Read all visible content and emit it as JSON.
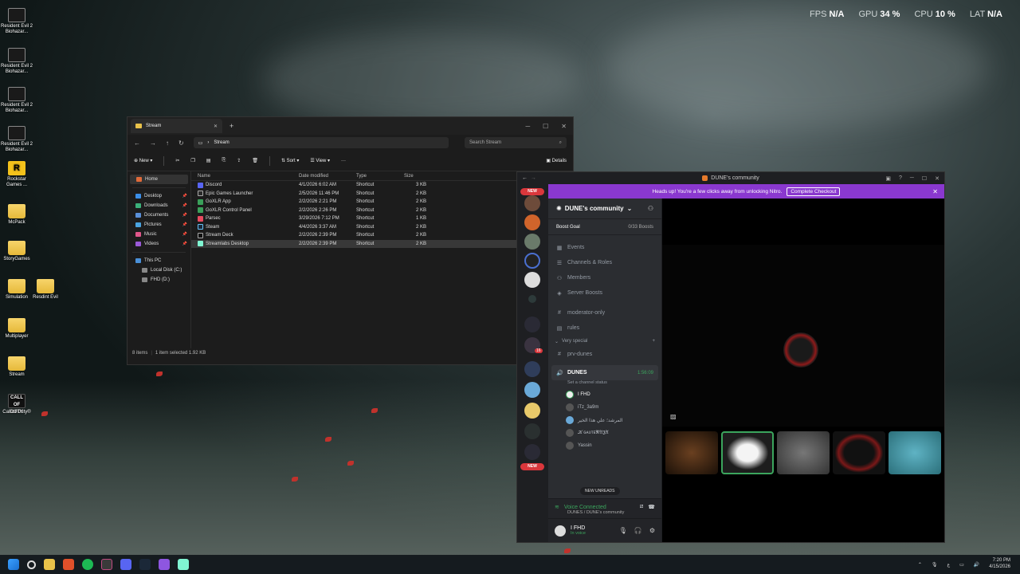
{
  "overlay": {
    "fps_label": "FPS",
    "fps": "N/A",
    "gpu_label": "GPU",
    "gpu": "34 %",
    "cpu_label": "CPU",
    "cpu": "10 %",
    "lat_label": "LAT",
    "lat": "N/A"
  },
  "desktop": {
    "icons": [
      {
        "label": "Resident Evil 2 Biohazar..."
      },
      {
        "label": "Resident Evil 2 Biohazar..."
      },
      {
        "label": "Resident Evil 2 Biohazar..."
      },
      {
        "label": "Resident Evil 2 Biohazar..."
      },
      {
        "label": "Rockstar Games ..."
      },
      {
        "label": "McPack"
      },
      {
        "label": "StoryGames"
      },
      {
        "label": "Simulation"
      },
      {
        "label": "Resdint Evil"
      },
      {
        "label": "Multiplayer"
      },
      {
        "label": "Stream"
      },
      {
        "label": "Call of Duty®"
      }
    ]
  },
  "explorer": {
    "tab_title": "Stream",
    "address": "Stream",
    "search_placeholder": "Search Stream",
    "toolbar": {
      "new": "New",
      "sort": "Sort",
      "view": "View",
      "details": "Details"
    },
    "nav": {
      "home": "Home",
      "desktop": "Desktop",
      "downloads": "Downloads",
      "documents": "Documents",
      "pictures": "Pictures",
      "music": "Music",
      "videos": "Videos",
      "this_pc": "This PC",
      "local_disk": "Local Disk (C:)",
      "fhd": "FHD (D:)"
    },
    "columns": {
      "name": "Name",
      "date": "Date modified",
      "type": "Type",
      "size": "Size"
    },
    "files": [
      {
        "name": "Discord",
        "date": "4/1/2026 6:02 AM",
        "type": "Shortcut",
        "size": "3 KB"
      },
      {
        "name": "Epic Games Launcher",
        "date": "2/5/2026 11:46 PM",
        "type": "Shortcut",
        "size": "2 KB"
      },
      {
        "name": "GoXLR App",
        "date": "2/2/2026 2:21 PM",
        "type": "Shortcut",
        "size": "2 KB"
      },
      {
        "name": "GoXLR Control Panel",
        "date": "2/2/2026 2:26 PM",
        "type": "Shortcut",
        "size": "2 KB"
      },
      {
        "name": "Parsec",
        "date": "3/29/2026 7:12 PM",
        "type": "Shortcut",
        "size": "1 KB"
      },
      {
        "name": "Steam",
        "date": "4/4/2026 3:37 AM",
        "type": "Shortcut",
        "size": "2 KB"
      },
      {
        "name": "Stream Deck",
        "date": "2/2/2026 2:39 PM",
        "type": "Shortcut",
        "size": "2 KB"
      },
      {
        "name": "Streamlabs Desktop",
        "date": "2/2/2026 2:39 PM",
        "type": "Shortcut",
        "size": "2 KB"
      }
    ],
    "status": {
      "items": "8 items",
      "selected": "1 item selected  1.92 KB"
    }
  },
  "discord": {
    "window_title": "DUNE's community",
    "new_badge": "NEW",
    "server_badge": "16",
    "nitro": {
      "text": "Heads up! You're a few clicks away from unlocking Nitro.",
      "button": "Complete Checkout"
    },
    "guild": "DUNE's community",
    "boost": {
      "label": "Boost Goal",
      "value": "0/33 Boosts"
    },
    "items": {
      "events": "Events",
      "channels_roles": "Channels & Roles",
      "members": "Members",
      "server_boosts": "Server Boosts",
      "moderator_only": "moderator-only",
      "rules": "rules",
      "category": "Very special",
      "prv_dunes": "prv-dunes",
      "voice": "DUNES",
      "voice_time": "1:56:09",
      "status_sub": "Set a channel status"
    },
    "voice_users": [
      "I FHD",
      "iTz_3a9m",
      "المرشد؛ علي هذا الخير",
      "𝓚 ɢᴀᴜᴛᴇ𝕽𝔄𝕵𝔄",
      "Yassin"
    ],
    "new_unreads": "NEW UNREADS",
    "voice_connected": {
      "title": "Voice Connected",
      "sub": "DUNES / DUNE's community"
    },
    "user": {
      "name": "I FHD",
      "sub": "In voice"
    }
  },
  "taskbar": {
    "time": "7:20 PM",
    "date": "4/15/2026"
  },
  "colors": {
    "discord_green": "#3ba55d",
    "nitro_purple": "#8a38cf",
    "folder_yellow": "#e9c24a"
  }
}
